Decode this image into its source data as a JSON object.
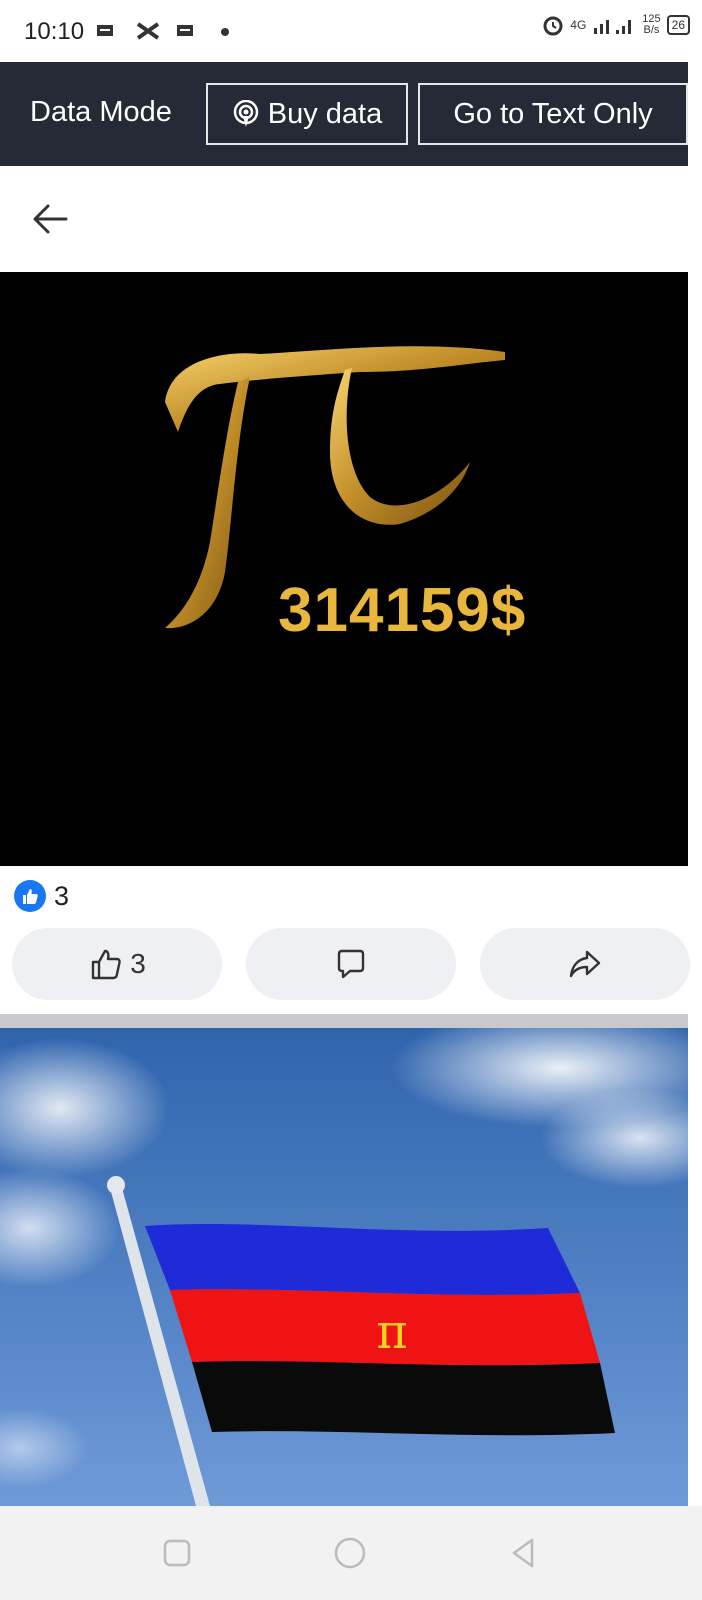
{
  "status_bar": {
    "time": "10:10",
    "network": "4G",
    "rate_value": "125",
    "rate_unit": "B/s",
    "battery": "26"
  },
  "data_bar": {
    "mode_label": "Data Mode",
    "buy_label": "Buy data",
    "text_only_label": "Go to Text Only"
  },
  "post": {
    "image_text": "314159$",
    "reaction_count": "3",
    "like_count": "3"
  },
  "flag_symbol": "π",
  "colors": {
    "like_blue": "#1877f2",
    "gold": "#e9b73e",
    "databar_bg": "#242a36"
  },
  "icons": {
    "back": "arrow-left-icon",
    "buy": "podcast-icon",
    "like": "thumbs-up-icon",
    "comment": "comment-icon",
    "share": "share-icon"
  }
}
